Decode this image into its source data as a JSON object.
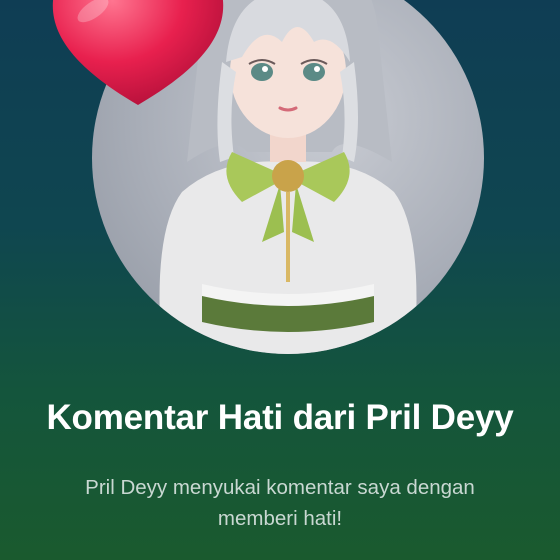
{
  "notification": {
    "title": "Komentar Hati dari Pril Deyy",
    "message": "Pril Deyy menyukai komentar saya dengan memberi hati!"
  },
  "icons": {
    "avatar": "user-avatar-anime-girl",
    "reaction": "heart-icon"
  },
  "colors": {
    "background_top": "#0f3d54",
    "background_bottom": "#1a5a2e",
    "heart": "#e8204e",
    "title": "#ffffff",
    "subtitle": "#c9d8d2"
  }
}
